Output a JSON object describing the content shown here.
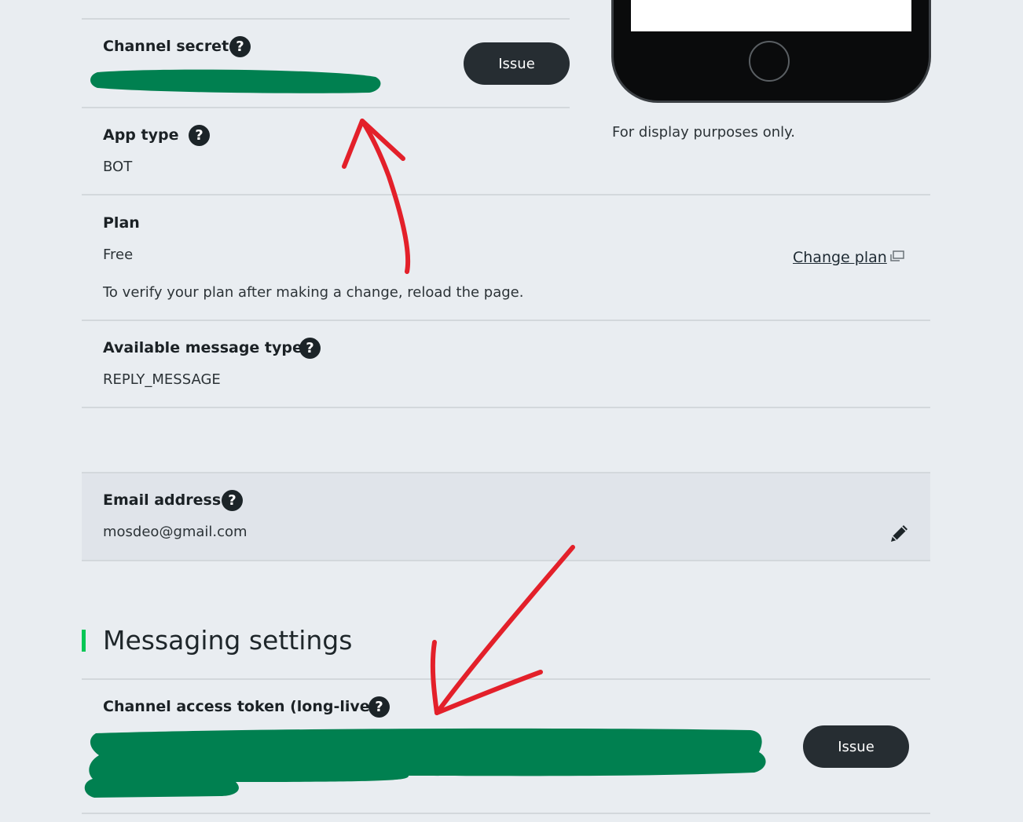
{
  "basic_settings": {
    "channel_secret": {
      "label": "Channel secret",
      "issue_label": "Issue"
    },
    "app_type": {
      "label": "App type",
      "value": "BOT"
    },
    "plan": {
      "label": "Plan",
      "value": "Free",
      "note": "To verify your plan after making a change, reload the page.",
      "change_link": "Change plan"
    },
    "message_types": {
      "label": "Available message types",
      "value": "REPLY_MESSAGE"
    },
    "email": {
      "label": "Email address",
      "value": "mosdeo@gmail.com"
    }
  },
  "preview": {
    "caption": "For display purposes only."
  },
  "messaging_settings": {
    "title": "Messaging settings",
    "access_token": {
      "label": "Channel access token (long-lived)",
      "issue_label": "Issue"
    }
  },
  "icons": {
    "help": "help-icon",
    "external": "external-link-icon",
    "edit": "pencil-icon"
  },
  "colors": {
    "background": "#e9edf1",
    "accent_green": "#06c755",
    "redaction_green": "#008050",
    "annotation_red": "#e3202a",
    "button_dark": "#262d32"
  }
}
